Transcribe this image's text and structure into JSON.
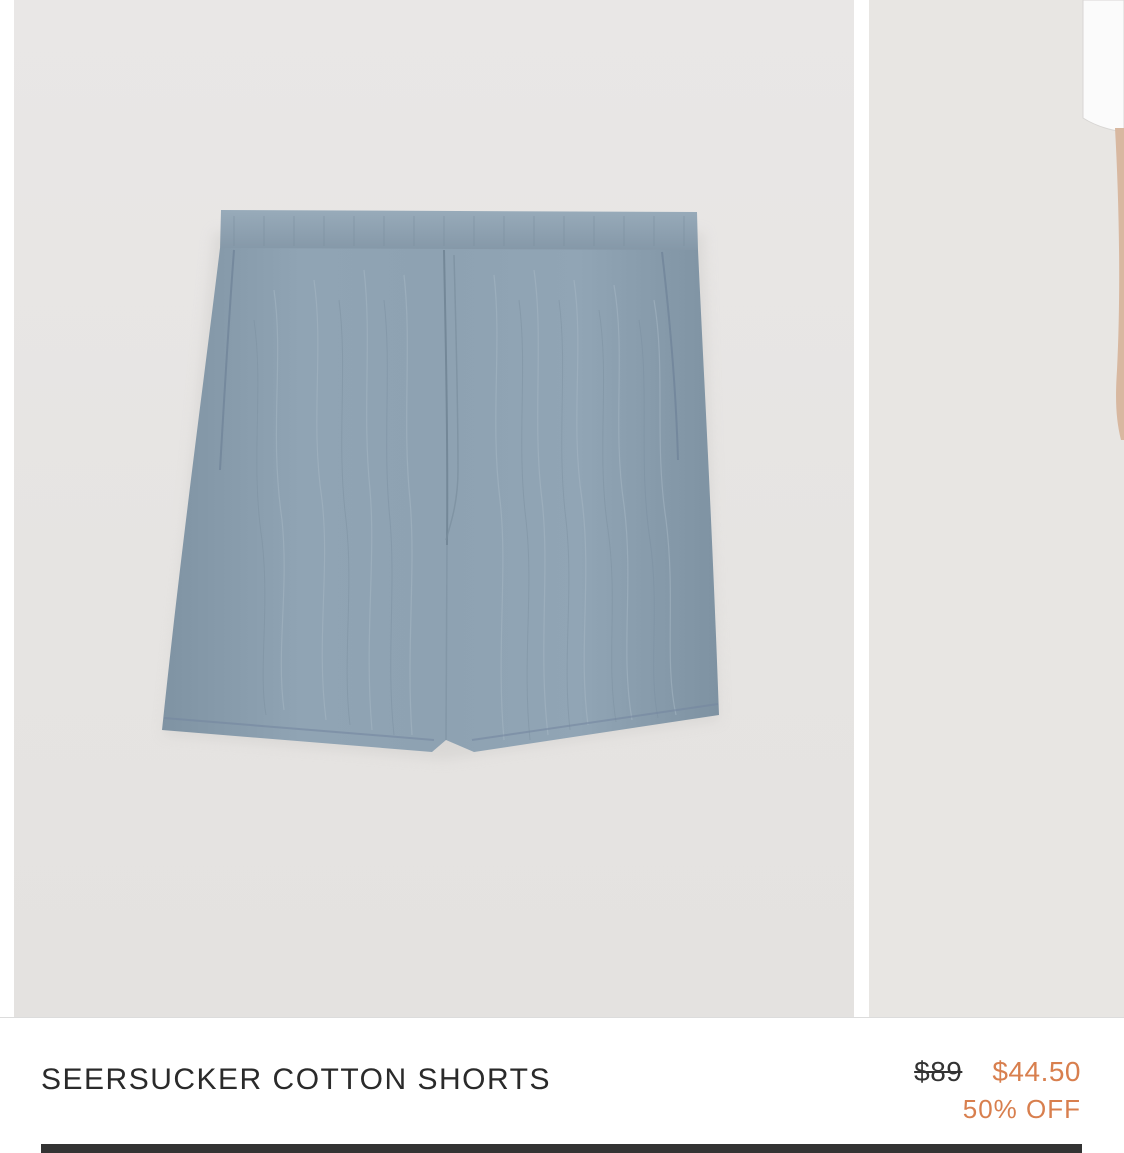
{
  "product": {
    "name": "SEERSUCKER COTTON SHORTS",
    "image_subject": "shorts-image",
    "color": "#8fa3b3"
  },
  "pricing": {
    "original": "$89",
    "sale": "$44.50",
    "discount": "50% OFF",
    "sale_color": "#d87f4e"
  }
}
